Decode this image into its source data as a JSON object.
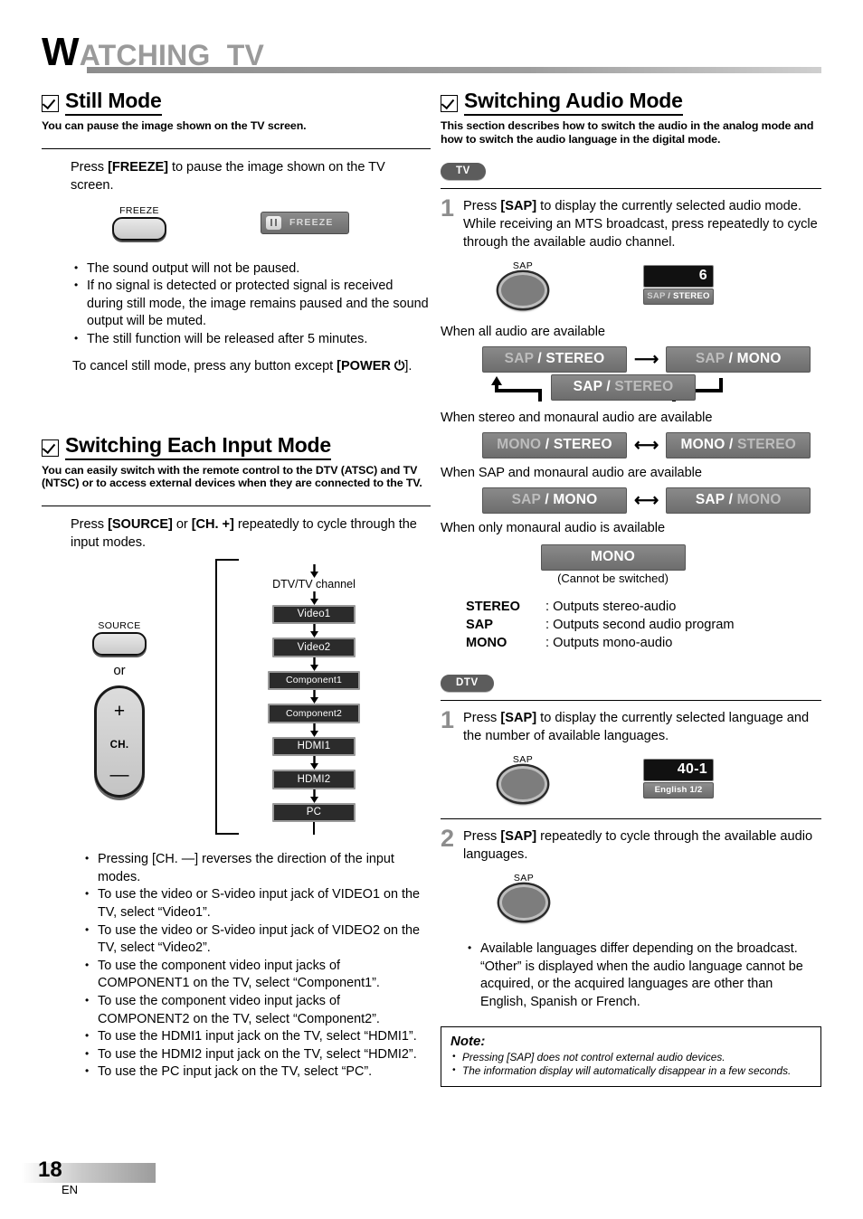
{
  "running_head": {
    "initial": "W",
    "rest": "ATCHING  TV"
  },
  "left": {
    "still": {
      "heading": "Still Mode",
      "subtitle": "You can pause the image shown on the TV screen.",
      "instruction_pre": "Press ",
      "instruction_key": "[FREEZE]",
      "instruction_post": " to pause the image shown on the TV screen.",
      "button_caption": "FREEZE",
      "osd_label": "FREEZE",
      "bullets": [
        "The sound output will not be paused.",
        "If no signal is detected or protected signal is received during still mode, the image remains paused and the sound output will be muted.",
        "The still function will be released after 5 minutes."
      ],
      "cancel_pre": "To cancel still mode, press any button except ",
      "cancel_key": "[POWER",
      "cancel_post": "]."
    },
    "input": {
      "heading": "Switching Each Input Mode",
      "subtitle": "You can easily switch with the remote control to the DTV (ATSC) and TV (NTSC) or to access external devices when they are connected to the TV.",
      "instruction_pre": "Press ",
      "instruction_key1": "[SOURCE]",
      "instruction_mid": " or ",
      "instruction_key2": "[CH. +]",
      "instruction_post": " repeatedly to cycle through the input modes.",
      "source_caption": "SOURCE",
      "or_label": "or",
      "ch_plus": "+",
      "ch_label": "CH.",
      "ch_minus": "—",
      "flow_top": "DTV/TV channel",
      "flow_items": [
        "Video1",
        "Video2",
        "Component1",
        "Component2",
        "HDMI1",
        "HDMI2",
        "PC"
      ],
      "bullets": [
        "Pressing [CH. —] reverses the direction of the input modes.",
        "To use the video or S-video input jack of VIDEO1 on the TV, select “Video1”.",
        "To use the video or S-video input jack of VIDEO2 on the TV, select “Video2”.",
        "To use the component video input jacks of COMPONENT1 on the TV, select “Component1”.",
        "To use the component video input jacks of COMPONENT2 on the TV, select “Component2”.",
        "To use the HDMI1 input jack on the TV, select “HDMI1”.",
        "To use the HDMI2 input jack on the TV, select “HDMI2”.",
        "To use the PC input jack on the TV, select “PC”."
      ]
    }
  },
  "right": {
    "audio": {
      "heading": "Switching Audio Mode",
      "subtitle": "This section describes how to switch the audio in the analog mode and how to switch the audio language in the digital mode.",
      "tv_tag": "TV",
      "dtv_tag": "DTV",
      "tv_step1_num": "1",
      "tv_step1_pre": "Press ",
      "tv_step1_key": "[SAP]",
      "tv_step1_post": " to display the currently selected audio mode. While receiving an MTS broadcast, press repeatedly to cycle through the available audio channel.",
      "sap_caption": "SAP",
      "osd_channel": "6",
      "osd_mode_dim": "SAP",
      "osd_mode_sep": " / ",
      "osd_mode_on": "STEREO",
      "cap_all": "When all audio are available",
      "cap_stereo_mono": "When stereo and monaural audio are available",
      "cap_sap_mono": "When SAP and monaural audio are available",
      "cap_mono_only": "When only monaural audio is available",
      "chips": {
        "all_a_off": "SAP",
        "all_a_sep": " / ",
        "all_a_on": "STEREO",
        "all_b_off": "SAP",
        "all_b_sep": " / ",
        "all_b_on": "MONO",
        "all_c_on": "SAP",
        "all_c_sep": " / ",
        "all_c_off": "STEREO",
        "sm_a_off": "MONO",
        "sm_a_sep": " / ",
        "sm_a_on": "STEREO",
        "sm_b_on": "MONO",
        "sm_b_sep": " / ",
        "sm_b_off": "STEREO",
        "sp_a_off": "SAP",
        "sp_a_sep": " / ",
        "sp_a_on": "MONO",
        "sp_b_on": "SAP",
        "sp_b_sep": " / ",
        "sp_b_off": "MONO",
        "mono_only": "MONO"
      },
      "mono_note": "(Cannot be switched)",
      "legend": [
        {
          "key": "STEREO",
          "value": ": Outputs stereo-audio"
        },
        {
          "key": "SAP",
          "value": ": Outputs second audio program"
        },
        {
          "key": "MONO",
          "value": ": Outputs mono-audio"
        }
      ],
      "dtv_step1_num": "1",
      "dtv_step1_pre": "Press ",
      "dtv_step1_key": "[SAP]",
      "dtv_step1_post": " to display the currently selected language and the number of available languages.",
      "dtv_osd_channel": "40-1",
      "dtv_osd_lang": "English 1/2",
      "dtv_step2_num": "2",
      "dtv_step2_pre": "Press ",
      "dtv_step2_key": "[SAP]",
      "dtv_step2_post": " repeatedly to cycle through the available audio languages.",
      "dtv_bullet": "Available languages differ depending on the broadcast. “Other” is displayed when the audio language cannot be acquired, or the acquired languages are other than English, Spanish or French.",
      "note_title": "Note:",
      "note_items": [
        "Pressing [SAP] does not control external audio devices.",
        "The information display will automatically disappear in a few seconds."
      ]
    }
  },
  "footer": {
    "page": "18",
    "lang": "EN"
  }
}
